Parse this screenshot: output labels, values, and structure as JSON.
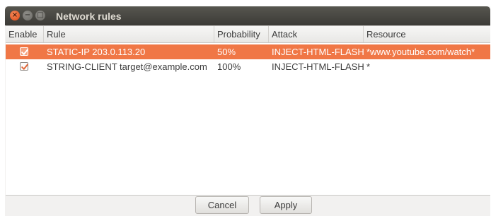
{
  "window": {
    "title": "Network rules"
  },
  "table": {
    "columns": [
      "Enable",
      "Rule",
      "Probability",
      "Attack",
      "Resource"
    ],
    "rows": [
      {
        "enabled": true,
        "selected": true,
        "rule": "STATIC-IP 203.0.113.20",
        "probability": "50%",
        "attack": "INJECT-HTML-FLASH",
        "resource": "*www.youtube.com/watch*"
      },
      {
        "enabled": true,
        "selected": false,
        "rule": "STRING-CLIENT target@example.com",
        "probability": "100%",
        "attack": "INJECT-HTML-FLASH",
        "resource": "*"
      }
    ]
  },
  "buttons": {
    "cancel_label": "Cancel",
    "apply_label": "Apply"
  },
  "colors": {
    "selection": "#f07746",
    "titlebar": "#3c3b37",
    "close_button": "#df4a16"
  }
}
